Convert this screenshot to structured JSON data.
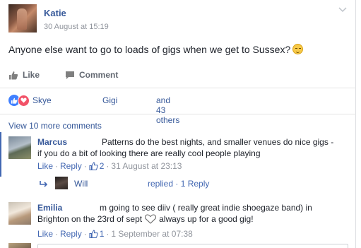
{
  "post": {
    "author": "Katie",
    "timestamp": "30 August at 15:19",
    "text": "Anyone else want to go to loads of gigs when we get to Sussex?",
    "emoji_icon": "relieved-face-emoji"
  },
  "actions": {
    "like_label": "Like",
    "comment_label": "Comment"
  },
  "likes": {
    "names": [
      "Skye",
      "Gigi"
    ],
    "others": "and 43 others",
    "like_color": "#4080ff",
    "love_color": "#f25268"
  },
  "view_more": "View 10 more comments",
  "comments": [
    {
      "author": "Marcus",
      "text_line1": "Patterns do the best nights, and smaller venues do nice gigs -",
      "text_line2": "if you do a bit of looking there are really cool people playing",
      "like_label": "Like",
      "reply_label": "Reply",
      "like_count": "2",
      "timestamp": "31 August at 23:13",
      "reply_preview": {
        "name": "Will",
        "summary": "replied",
        "count_label": "1 Reply"
      }
    },
    {
      "author": "Emilia",
      "text_line1": "m going to see diiv ( really great indie shoegaze band) in",
      "text_line2_a": "Brighton on the 23rd of sept",
      "text_line2_b": "always up for a good gig!",
      "like_label": "Like",
      "reply_label": "Reply",
      "like_count": "1",
      "timestamp": "1 September at 07:38"
    }
  ],
  "colors": {
    "link": "#365899",
    "meta": "#90949c",
    "accent": "#4267b2"
  }
}
